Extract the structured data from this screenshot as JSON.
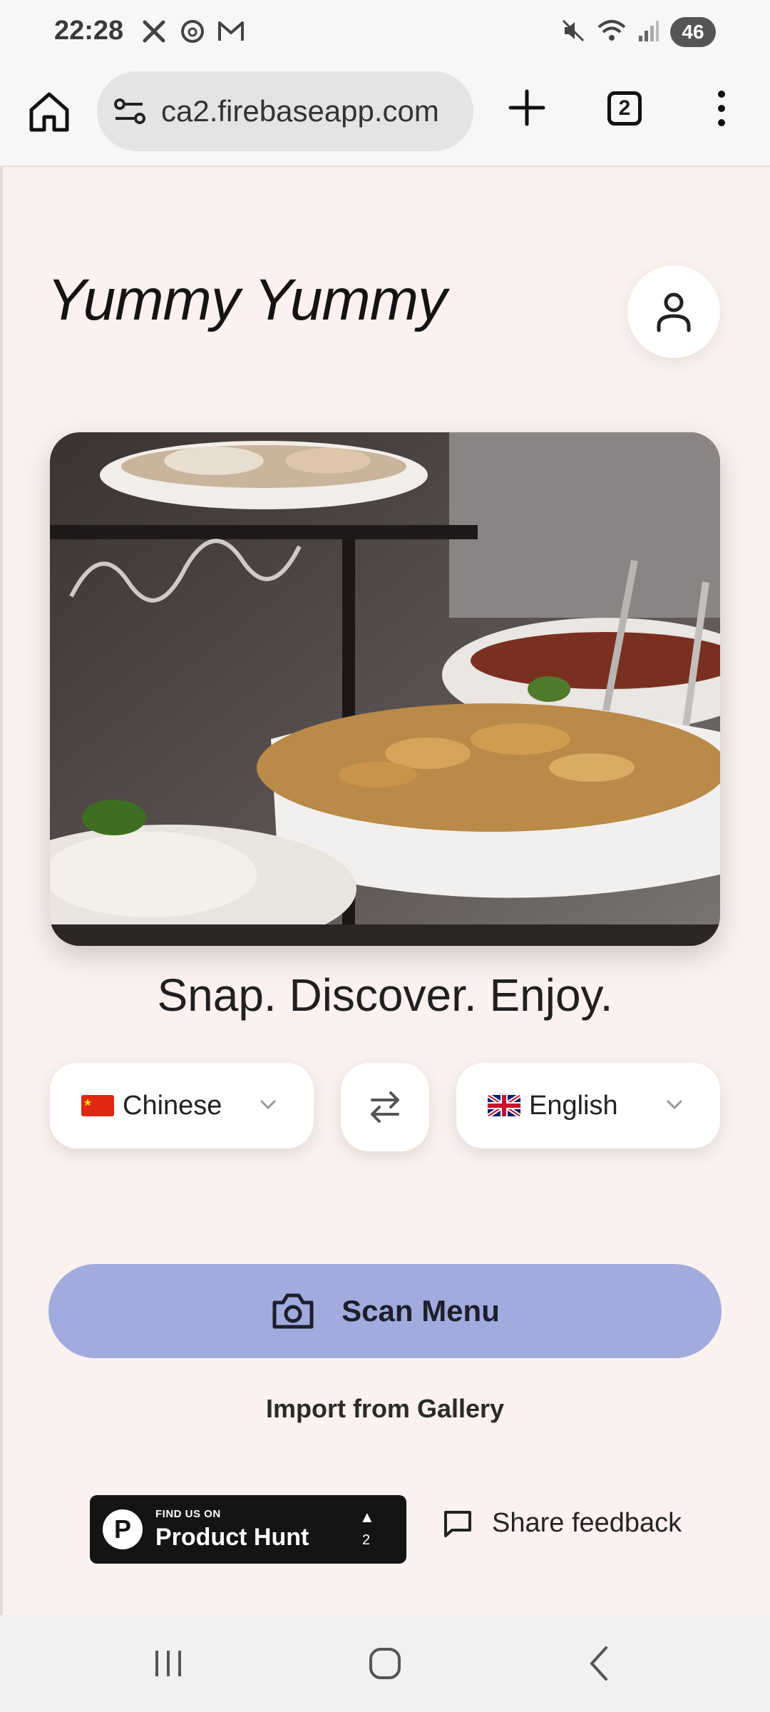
{
  "status_bar": {
    "time": "22:28",
    "battery": "46",
    "left_icons": [
      "x-icon",
      "threads-icon",
      "gmail-icon"
    ],
    "right_icons": [
      "mute-icon",
      "wifi-icon",
      "signal-icon"
    ]
  },
  "browser": {
    "url": "ca2.firebaseapp.com",
    "tab_count": "2"
  },
  "app": {
    "title": "Yummy Yummy",
    "tagline": "Snap. Discover. Enjoy.",
    "source_language": "Chinese",
    "target_language": "English",
    "scan_button": "Scan Menu",
    "gallery_link": "Import from Gallery",
    "product_hunt": {
      "small": "FIND US ON",
      "big": "Product Hunt",
      "count": "2"
    },
    "feedback": "Share feedback"
  },
  "colors": {
    "page_bg": "#fbf1ee",
    "scan_button": "#a1abde",
    "product_hunt_bg": "#141414"
  }
}
